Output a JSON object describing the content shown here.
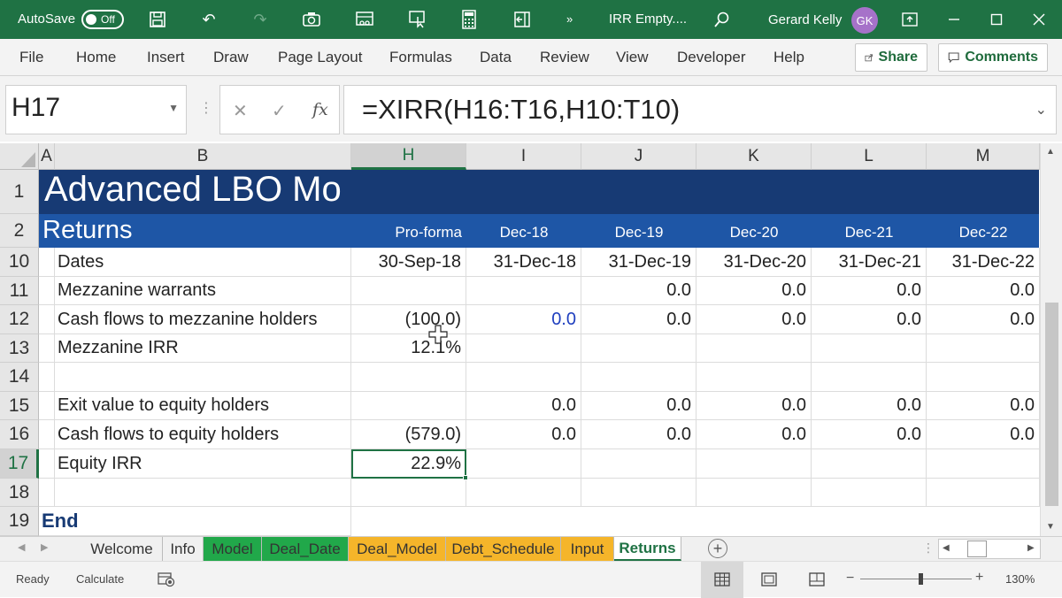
{
  "titlebar": {
    "autosave_label": "AutoSave",
    "autosave_state": "Off",
    "more_label": "»",
    "file_name": "IRR Empty....",
    "user_name": "Gerard Kelly",
    "user_initials": "GK"
  },
  "ribbon": {
    "menus": [
      "File",
      "Home",
      "Insert",
      "Draw",
      "Page Layout",
      "Formulas",
      "Data",
      "Review",
      "View",
      "Developer",
      "Help"
    ],
    "share_label": "Share",
    "comments_label": "Comments"
  },
  "formula_bar": {
    "name_box": "H17",
    "fx_label": "fx",
    "formula": "=XIRR(H16:T16,H10:T10)"
  },
  "columns": [
    "A",
    "B",
    "H",
    "I",
    "J",
    "K",
    "L",
    "M"
  ],
  "rows": [
    "1",
    "2",
    "10",
    "11",
    "12",
    "13",
    "14",
    "15",
    "16",
    "17",
    "18",
    "19"
  ],
  "sheet": {
    "title": "Advanced LBO Mo",
    "subtitle": "Returns",
    "period_headers": [
      "Pro-forma",
      "Dec-18",
      "Dec-19",
      "Dec-20",
      "Dec-21",
      "Dec-22"
    ],
    "data_rows": [
      {
        "label": "Dates",
        "values": [
          "30-Sep-18",
          "31-Dec-18",
          "31-Dec-19",
          "31-Dec-20",
          "31-Dec-21",
          "31-Dec-22"
        ]
      },
      {
        "label": "Mezzanine warrants",
        "values": [
          "",
          "",
          "0.0",
          "0.0",
          "0.0",
          "0.0"
        ]
      },
      {
        "label": "Cash flows to mezzanine holders",
        "values": [
          "(100.0)",
          "0.0",
          "0.0",
          "0.0",
          "0.0",
          "0.0"
        ]
      },
      {
        "label": "Mezzanine IRR",
        "values": [
          "12.1%",
          "",
          "",
          "",
          "",
          ""
        ]
      },
      {
        "label": "",
        "values": [
          "",
          "",
          "",
          "",
          "",
          ""
        ]
      },
      {
        "label": "Exit value to equity holders",
        "values": [
          "",
          "0.0",
          "0.0",
          "0.0",
          "0.0",
          "0.0"
        ]
      },
      {
        "label": "Cash flows to equity holders",
        "values": [
          "(579.0)",
          "0.0",
          "0.0",
          "0.0",
          "0.0",
          "0.0"
        ]
      },
      {
        "label": "Equity IRR",
        "values": [
          "22.9%",
          "",
          "",
          "",
          "",
          ""
        ]
      },
      {
        "label": "",
        "values": [
          "",
          "",
          "",
          "",
          "",
          ""
        ]
      }
    ],
    "end_label": "End",
    "input_color": "#1f3fbf"
  },
  "tabs": [
    {
      "label": "Welcome",
      "color": "#f0f0f0"
    },
    {
      "label": "Info",
      "color": "#f0f0f0"
    },
    {
      "label": "Model",
      "color": "#21a84a"
    },
    {
      "label": "Deal_Date",
      "color": "#21a84a"
    },
    {
      "label": "Deal_Model",
      "color": "#f5b52a"
    },
    {
      "label": "Debt_Schedule",
      "color": "#f5b52a"
    },
    {
      "label": "Input",
      "color": "#f5b52a"
    },
    {
      "label": "Returns",
      "color": "#ffffff",
      "active": true
    }
  ],
  "status": {
    "ready": "Ready",
    "calculate": "Calculate",
    "zoom": "130%"
  },
  "colors": {
    "excel_green": "#1f7244",
    "title_band": "#173a74",
    "subtitle_band": "#1e56a6"
  }
}
